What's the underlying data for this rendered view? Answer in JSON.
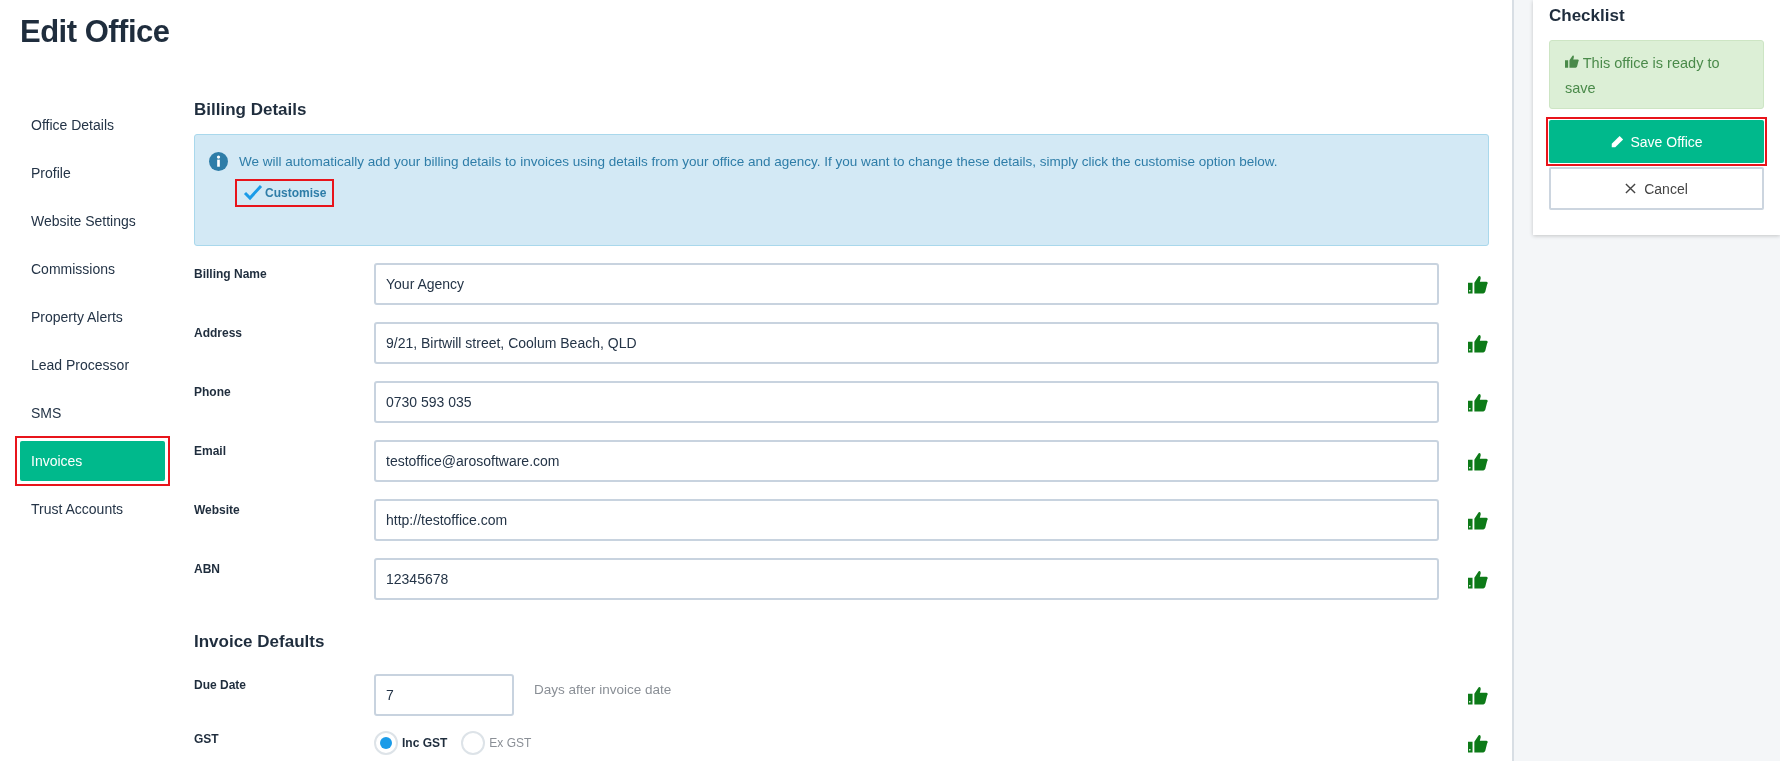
{
  "page_title": "Edit Office",
  "sidebar": {
    "items": [
      {
        "label": "Office Details",
        "selected": false,
        "highlighted": false
      },
      {
        "label": "Profile",
        "selected": false,
        "highlighted": false
      },
      {
        "label": "Website Settings",
        "selected": false,
        "highlighted": false
      },
      {
        "label": "Commissions",
        "selected": false,
        "highlighted": false
      },
      {
        "label": "Property Alerts",
        "selected": false,
        "highlighted": false
      },
      {
        "label": "Lead Processor",
        "selected": false,
        "highlighted": false
      },
      {
        "label": "SMS",
        "selected": false,
        "highlighted": false
      },
      {
        "label": "Invoices",
        "selected": true,
        "highlighted": true
      },
      {
        "label": "Trust Accounts",
        "selected": false,
        "highlighted": false
      }
    ]
  },
  "billing_details": {
    "heading": "Billing Details",
    "info": {
      "text": "We will automatically add your billing details to invoices using details from your office and agency. If you want to change these details, simply click the customise option below.",
      "customise": {
        "label": "Customise",
        "checked": true,
        "highlighted": true
      }
    },
    "fields": [
      {
        "label": "Billing Name",
        "value": "Your Agency",
        "valid": true
      },
      {
        "label": "Address",
        "value": "9/21, Birtwill street, Coolum Beach, QLD",
        "valid": true
      },
      {
        "label": "Phone",
        "value": "0730 593 035",
        "valid": true
      },
      {
        "label": "Email",
        "value": "testoffice@arosoftware.com",
        "valid": true
      },
      {
        "label": "Website",
        "value": "http://testoffice.com",
        "valid": true
      },
      {
        "label": "ABN",
        "value": "12345678",
        "valid": true
      }
    ]
  },
  "invoice_defaults": {
    "heading": "Invoice Defaults",
    "due_date": {
      "label": "Due Date",
      "value": "7",
      "suffix": "Days after invoice date",
      "valid": true
    },
    "gst": {
      "label": "GST",
      "valid": true,
      "options": [
        {
          "label": "Inc GST",
          "selected": true
        },
        {
          "label": "Ex GST",
          "selected": false
        }
      ]
    }
  },
  "checklist": {
    "title": "Checklist",
    "status": "This office is ready to save",
    "ready": true,
    "save_button": {
      "label": "Save Office",
      "highlighted": true
    },
    "cancel_button": {
      "label": "Cancel"
    }
  }
}
